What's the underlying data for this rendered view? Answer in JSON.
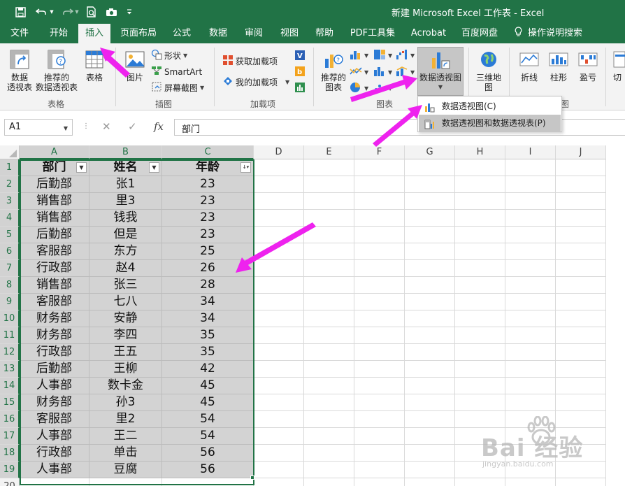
{
  "window": {
    "title": "新建 Microsoft Excel 工作表  -  Excel",
    "qat_icons": [
      "save-icon",
      "undo-icon",
      "redo-icon",
      "print-preview-icon",
      "camera-icon",
      "customize-qat-icon"
    ]
  },
  "tabs": [
    {
      "label": "文件",
      "active": false
    },
    {
      "label": "开始",
      "active": false
    },
    {
      "label": "插入",
      "active": true
    },
    {
      "label": "页面布局",
      "active": false
    },
    {
      "label": "公式",
      "active": false
    },
    {
      "label": "数据",
      "active": false
    },
    {
      "label": "审阅",
      "active": false
    },
    {
      "label": "视图",
      "active": false
    },
    {
      "label": "帮助",
      "active": false
    },
    {
      "label": "PDF工具集",
      "active": false
    },
    {
      "label": "Acrobat",
      "active": false
    },
    {
      "label": "百度网盘",
      "active": false
    }
  ],
  "tell_me": {
    "label": "操作说明搜索",
    "icon": "lightbulb-icon"
  },
  "ribbon": {
    "groups": {
      "tables": "表格",
      "illustrations": "插图",
      "addins": "加载项",
      "charts": "图表",
      "tours": "图"
    },
    "tables": {
      "pivot_table_l1": "数据",
      "pivot_table_l2": "透视表",
      "recommended_l1": "推荐的",
      "recommended_l2": "数据透视表",
      "table": "表格"
    },
    "illustrations": {
      "pictures": "图片",
      "shapes": "形状",
      "smartart": "SmartArt",
      "screenshot": "屏幕截图"
    },
    "addins": {
      "get_addins": "获取加载项",
      "my_addins": "我的加载项"
    },
    "charts": {
      "recommended_l1": "推荐的",
      "recommended_l2": "图表",
      "pivot_chart": "数据透视图"
    },
    "tours": {
      "map3d_l1": "三维地",
      "map3d_l2": "图"
    },
    "sparklines": {
      "line": "折线",
      "column": "柱形",
      "win_loss": "盈亏"
    },
    "truncated": "切"
  },
  "dropdown": {
    "items": [
      {
        "label": "数据透视图(C)",
        "hover": false
      },
      {
        "label": "数据透视图和数据透视表(P)",
        "hover": true
      }
    ]
  },
  "formula_bar": {
    "name_box": "A1",
    "value": "部门"
  },
  "sheet": {
    "columns": [
      "A",
      "B",
      "C",
      "D",
      "E",
      "F",
      "G",
      "H",
      "I",
      "J"
    ],
    "row_numbers": [
      "1",
      "2",
      "3",
      "4",
      "5",
      "6",
      "7",
      "8",
      "9",
      "10",
      "11",
      "12",
      "13",
      "14",
      "15",
      "16",
      "17",
      "18",
      "19",
      "20"
    ],
    "headers": [
      "部门",
      "姓名",
      "年龄"
    ],
    "rows": [
      [
        "后勤部",
        "张1",
        "23"
      ],
      [
        "销售部",
        "里3",
        "23"
      ],
      [
        "销售部",
        "钱我",
        "23"
      ],
      [
        "后勤部",
        "但是",
        "23"
      ],
      [
        "客服部",
        "东方",
        "25"
      ],
      [
        "行政部",
        "赵4",
        "26"
      ],
      [
        "销售部",
        "张三",
        "28"
      ],
      [
        "客服部",
        "七八",
        "34"
      ],
      [
        "财务部",
        "安静",
        "34"
      ],
      [
        "财务部",
        "李四",
        "35"
      ],
      [
        "行政部",
        "王五",
        "35"
      ],
      [
        "后勤部",
        "王柳",
        "42"
      ],
      [
        "人事部",
        "数卡金",
        "45"
      ],
      [
        "财务部",
        "孙3",
        "45"
      ],
      [
        "客服部",
        "里2",
        "54"
      ],
      [
        "人事部",
        "王二",
        "54"
      ],
      [
        "行政部",
        "单击",
        "56"
      ],
      [
        "人事部",
        "豆腐",
        "56"
      ]
    ]
  },
  "watermark": {
    "main": "Bai  经验",
    "sub": "jingyan.baidu.com"
  },
  "colors": {
    "excel_green": "#217346",
    "arrow_magenta": "#ee22ee",
    "selection_gray": "#d3d3d3"
  }
}
